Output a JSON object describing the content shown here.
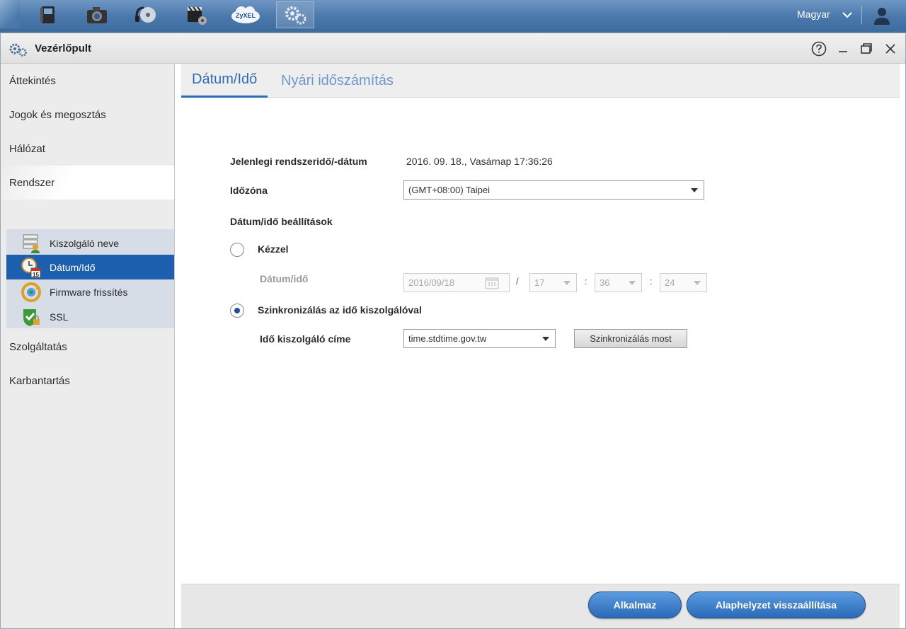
{
  "taskbar": {
    "apps": [
      {
        "icon": "file-browser-icon"
      },
      {
        "icon": "photo-camera-icon"
      },
      {
        "icon": "music-player-icon"
      },
      {
        "icon": "video-player-icon"
      },
      {
        "icon": "zyxel-cloud-icon",
        "label": "ZyXEL"
      },
      {
        "icon": "control-panel-gears-icon"
      }
    ],
    "language": "Magyar"
  },
  "window": {
    "title": "Vezérlőpult"
  },
  "sidebar": {
    "items": [
      {
        "label": "Áttekintés"
      },
      {
        "label": "Jogok és megosztás"
      },
      {
        "label": "Hálózat"
      },
      {
        "label": "Rendszer"
      },
      {
        "label": "Szolgáltatás"
      },
      {
        "label": "Karbantartás"
      }
    ],
    "subitems": [
      {
        "label": "Kiszolgáló neve",
        "icon": "server-name-icon"
      },
      {
        "label": "Dátum/Idő",
        "icon": "date-time-icon",
        "selected": true
      },
      {
        "label": "Firmware frissítés",
        "icon": "firmware-update-icon"
      },
      {
        "label": "SSL",
        "icon": "ssl-shield-icon"
      }
    ]
  },
  "tabs": [
    {
      "label": "Dátum/Idő",
      "active": true
    },
    {
      "label": "Nyári időszámítás",
      "active": false
    }
  ],
  "form": {
    "current_label": "Jelenlegi rendszeridő/-dátum",
    "current_value": "2016. 09. 18., Vasárnap 17:36:26",
    "timezone_label": "Időzóna",
    "timezone_value": "(GMT+08:00) Taipei",
    "settings_heading": "Dátum/idő beállítások",
    "manual_label": "Kézzel",
    "manual_checked": false,
    "datetime_label": "Dátum/idő",
    "date_value": "2016/09/18",
    "slash": "/",
    "hour": "17",
    "colon": ":",
    "minute": "36",
    "second": "24",
    "sync_label": "Szinkronizálás az idő kiszolgálóval",
    "sync_checked": true,
    "server_label": "Idő kiszolgáló címe",
    "server_value": "time.stdtime.gov.tw",
    "sync_now_label": "Szinkronizálás most"
  },
  "footer": {
    "apply_label": "Alkalmaz",
    "reset_label": "Alaphelyzet visszaállítása"
  },
  "colors": {
    "accent": "#1c5fae",
    "tab_active": "#2d6db6",
    "taskbar": "#4a78aa"
  }
}
